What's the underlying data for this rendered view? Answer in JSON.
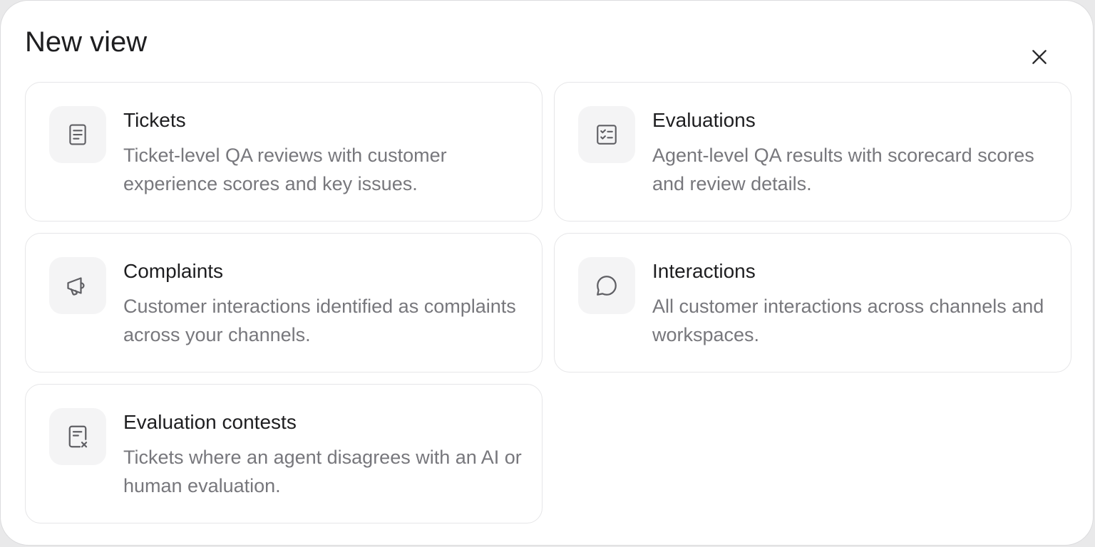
{
  "dialog": {
    "title": "New view",
    "close_icon": "close-icon"
  },
  "cards": [
    {
      "title": "Tickets",
      "description": "Ticket-level QA reviews with customer experience scores and key issues.",
      "icon": "document-icon"
    },
    {
      "title": "Evaluations",
      "description": "Agent-level QA results with scorecard scores and review details.",
      "icon": "checklist-icon"
    },
    {
      "title": "Complaints",
      "description": "Customer interactions identified as complaints across your channels.",
      "icon": "megaphone-icon"
    },
    {
      "title": "Interactions",
      "description": "All customer interactions across channels and workspaces.",
      "icon": "chat-bubble-icon"
    },
    {
      "title": "Evaluation contests",
      "description": "Tickets where an agent disagrees with an AI or human evaluation.",
      "icon": "document-x-icon"
    }
  ],
  "colors": {
    "text_primary": "#1e1e20",
    "text_secondary": "#77777c",
    "icon_tile": "#f4f4f5",
    "card_border": "#e6e6e8"
  }
}
